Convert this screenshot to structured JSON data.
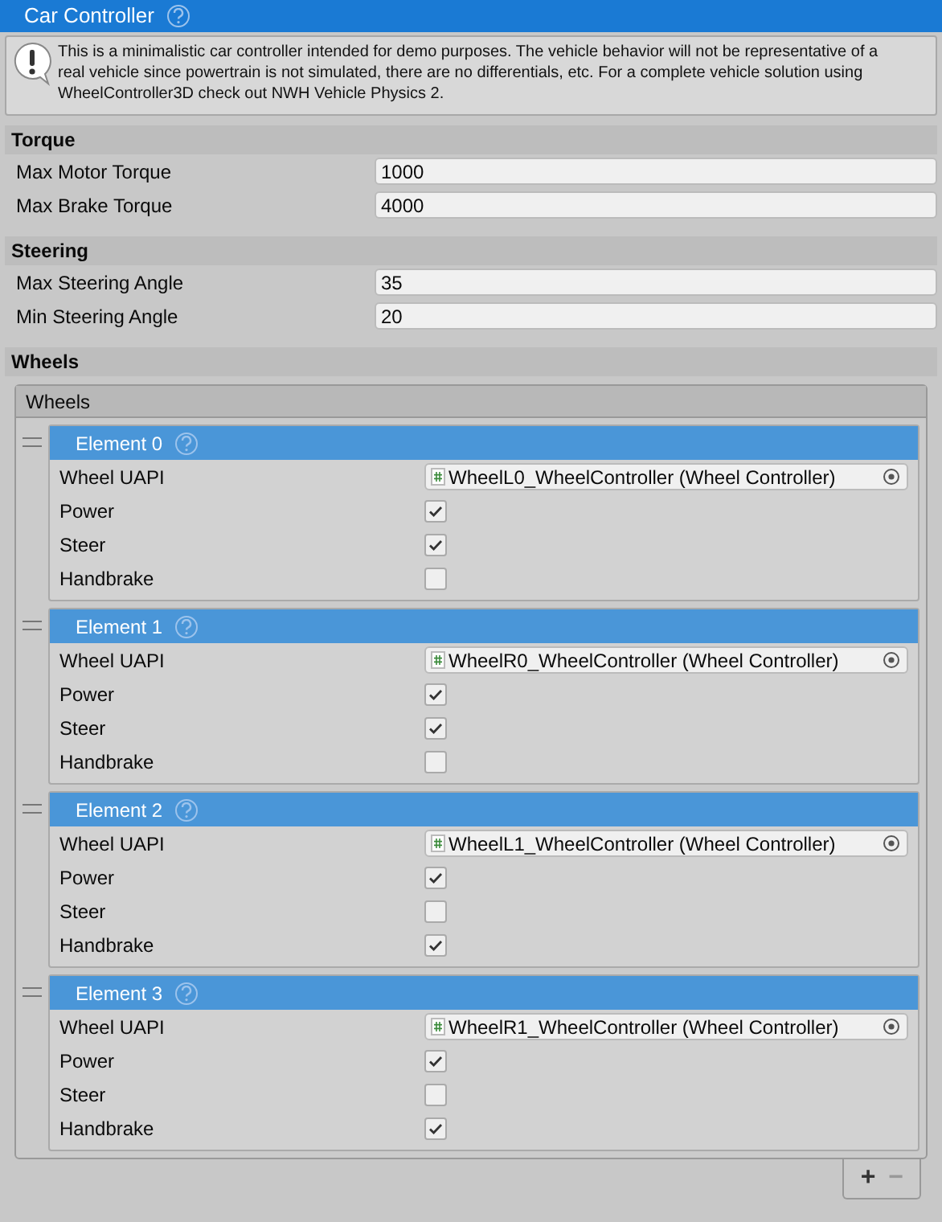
{
  "title": "Car Controller",
  "help_text": "This is a minimalistic car controller intended for demo purposes. The vehicle behavior will not be representative of a real vehicle since powertrain is not simulated, there are no differentials, etc. For a complete vehicle solution using WheelController3D check out NWH Vehicle Physics 2.",
  "sections": [
    {
      "title": "Torque",
      "fields": [
        {
          "label": "Max Motor Torque",
          "value": "1000"
        },
        {
          "label": "Max Brake Torque",
          "value": "4000"
        }
      ]
    },
    {
      "title": "Steering",
      "fields": [
        {
          "label": "Max Steering Angle",
          "value": "35"
        },
        {
          "label": "Min Steering Angle",
          "value": "20"
        }
      ]
    }
  ],
  "wheels": {
    "title": "Wheels",
    "list_title": "Wheels",
    "elements": [
      {
        "title": "Element 0",
        "fields": [
          {
            "kind": "object",
            "label": "Wheel UAPI",
            "value": "WheelL0_WheelController (Wheel Controller)"
          },
          {
            "kind": "checkbox",
            "label": "Power",
            "checked": true
          },
          {
            "kind": "checkbox",
            "label": "Steer",
            "checked": true
          },
          {
            "kind": "checkbox",
            "label": "Handbrake",
            "checked": false
          }
        ]
      },
      {
        "title": "Element 1",
        "fields": [
          {
            "kind": "object",
            "label": "Wheel UAPI",
            "value": "WheelR0_WheelController (Wheel Controller)"
          },
          {
            "kind": "checkbox",
            "label": "Power",
            "checked": true
          },
          {
            "kind": "checkbox",
            "label": "Steer",
            "checked": true
          },
          {
            "kind": "checkbox",
            "label": "Handbrake",
            "checked": false
          }
        ]
      },
      {
        "title": "Element 2",
        "fields": [
          {
            "kind": "object",
            "label": "Wheel UAPI",
            "value": "WheelL1_WheelController (Wheel Controller)"
          },
          {
            "kind": "checkbox",
            "label": "Power",
            "checked": true
          },
          {
            "kind": "checkbox",
            "label": "Steer",
            "checked": false
          },
          {
            "kind": "checkbox",
            "label": "Handbrake",
            "checked": true
          }
        ]
      },
      {
        "title": "Element 3",
        "fields": [
          {
            "kind": "object",
            "label": "Wheel UAPI",
            "value": "WheelR1_WheelController (Wheel Controller)"
          },
          {
            "kind": "checkbox",
            "label": "Power",
            "checked": true
          },
          {
            "kind": "checkbox",
            "label": "Steer",
            "checked": false
          },
          {
            "kind": "checkbox",
            "label": "Handbrake",
            "checked": true
          }
        ]
      }
    ],
    "buttons": [
      "+",
      "−"
    ]
  }
}
